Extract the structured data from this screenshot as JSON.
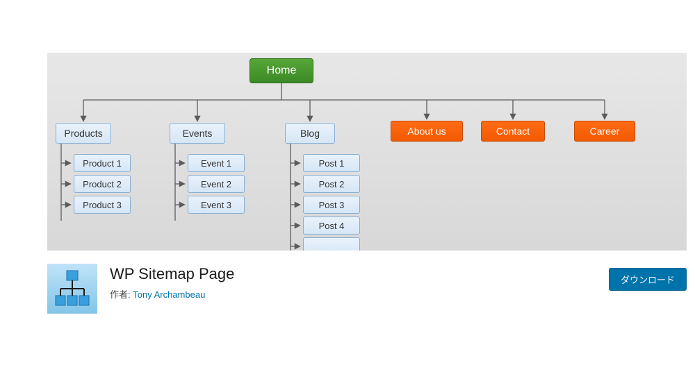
{
  "diagram": {
    "root": "Home",
    "categories": [
      {
        "label": "Products",
        "children": [
          "Product 1",
          "Product 2",
          "Product 3"
        ]
      },
      {
        "label": "Events",
        "children": [
          "Event 1",
          "Event 2",
          "Event 3"
        ]
      },
      {
        "label": "Blog",
        "children": [
          "Post 1",
          "Post 2",
          "Post 3",
          "Post 4"
        ]
      }
    ],
    "pages": [
      {
        "label": "About us"
      },
      {
        "label": "Contact"
      },
      {
        "label": "Career"
      }
    ]
  },
  "plugin": {
    "title": "WP Sitemap Page",
    "author_label": "作者: ",
    "author_name": "Tony Archambeau",
    "download_label": "ダウンロード"
  }
}
